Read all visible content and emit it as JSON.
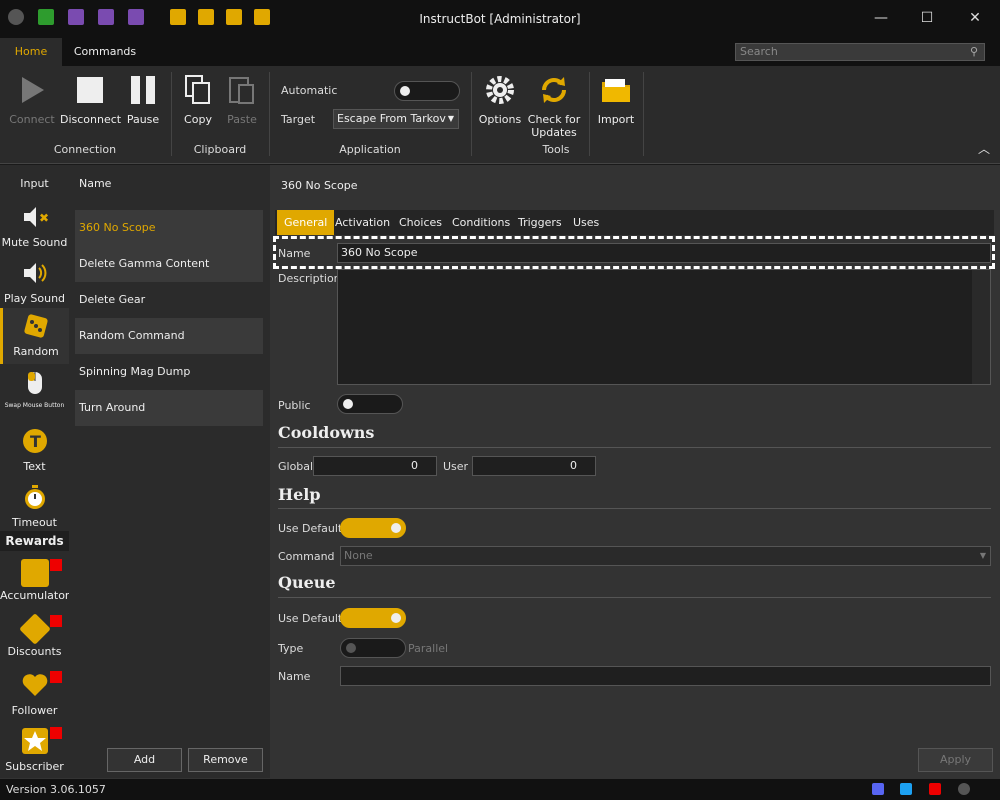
{
  "window": {
    "title": "InstructBot [Administrator]"
  },
  "ribbon_tabs": [
    "Home",
    "Commands"
  ],
  "search": {
    "placeholder": "Search"
  },
  "ribbon": {
    "connect": "Connect",
    "disconnect": "Disconnect",
    "pause": "Pause",
    "copy": "Copy",
    "paste": "Paste",
    "automatic": "Automatic",
    "target": "Target",
    "target_value": "Escape From Tarkov",
    "options": "Options",
    "check_updates_1": "Check for",
    "check_updates_2": "Updates",
    "import": "Import",
    "groups": {
      "connection": "Connection",
      "clipboard": "Clipboard",
      "application": "Application",
      "tools": "Tools"
    }
  },
  "nav": {
    "items": [
      "Input",
      "Mute Sound",
      "Play Sound",
      "Random",
      "Swap Mouse Button",
      "Text",
      "Timeout"
    ],
    "rewards_header": "Rewards",
    "rewards": [
      "Accumulator",
      "Discounts",
      "Follower",
      "Subscriber"
    ]
  },
  "list": {
    "header": "Name",
    "items": [
      "360 No Scope",
      "Delete Gamma Content",
      "Delete Gear",
      "Random Command",
      "Spinning Mag Dump",
      "Turn Around"
    ],
    "add": "Add",
    "remove": "Remove"
  },
  "detail": {
    "title": "360 No Scope",
    "tabs": [
      "General",
      "Activation",
      "Choices",
      "Conditions",
      "Triggers",
      "Uses"
    ],
    "name_label": "Name",
    "name_value": "360 No Scope",
    "description_label": "Description",
    "public_label": "Public",
    "cooldowns": "Cooldowns",
    "global_label": "Global",
    "global_value": "0",
    "user_label": "User",
    "user_value": "0",
    "help": "Help",
    "use_default": "Use Default",
    "command_label": "Command",
    "command_value": "None",
    "queue": "Queue",
    "queue_use_default": "Use Default",
    "type_label": "Type",
    "type_value": "Parallel",
    "queue_name_label": "Name",
    "apply": "Apply"
  },
  "status": {
    "version": "Version 3.06.1057"
  },
  "colors": {
    "accent": "#e0a800",
    "bg": "#333333"
  }
}
